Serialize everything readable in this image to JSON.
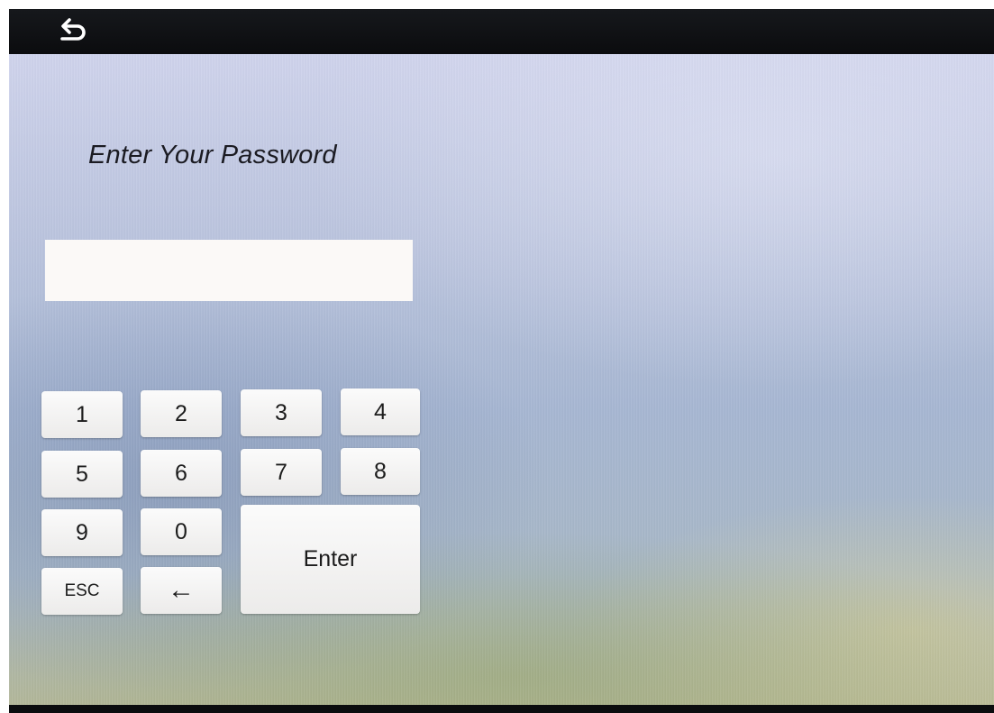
{
  "title": "Enter Your Password",
  "password_field": {
    "value": "",
    "placeholder": ""
  },
  "keypad": {
    "k1": "1",
    "k2": "2",
    "k3": "3",
    "k4": "4",
    "k5": "5",
    "k6": "6",
    "k7": "7",
    "k8": "8",
    "k9": "9",
    "k0": "0",
    "esc": "ESC",
    "backspace": "←",
    "enter": "Enter"
  },
  "icons": {
    "back": "return-arrow-icon"
  }
}
